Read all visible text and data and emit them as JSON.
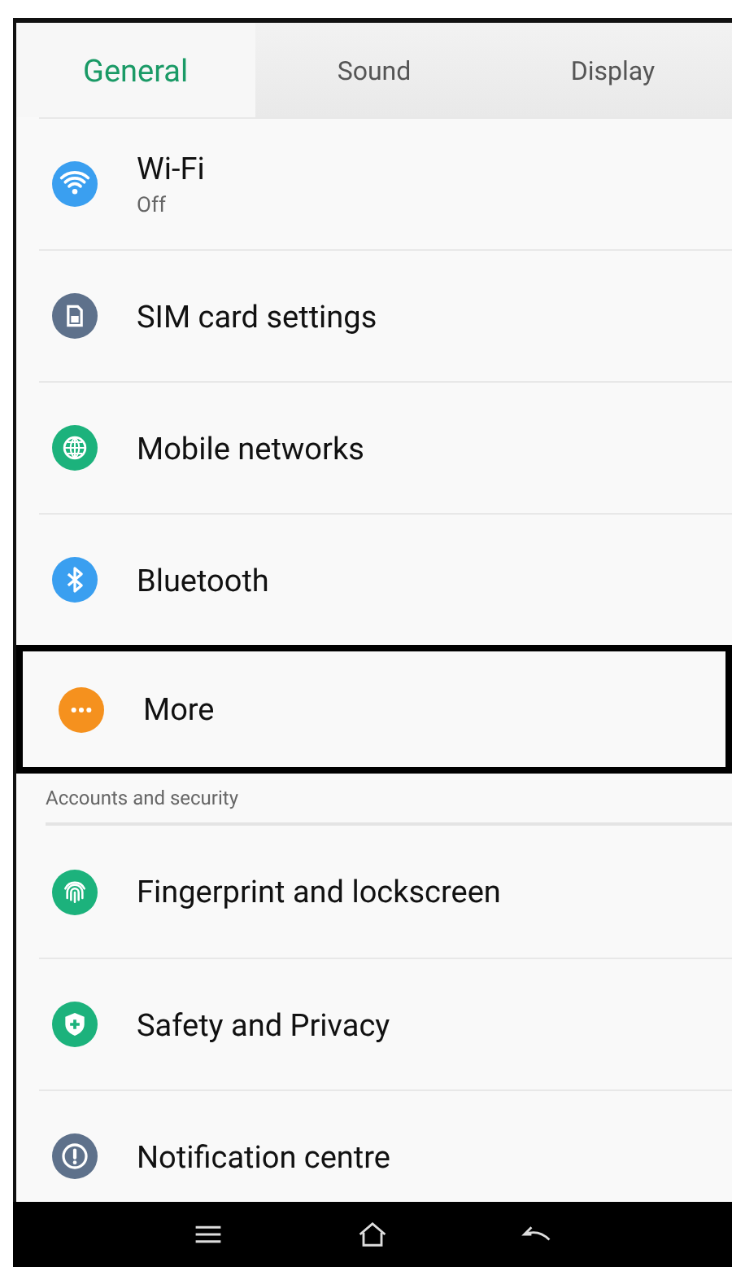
{
  "tabs": [
    {
      "label": "General",
      "selected": true
    },
    {
      "label": "Sound",
      "selected": false
    },
    {
      "label": "Display",
      "selected": false
    }
  ],
  "sections": [
    {
      "items": [
        {
          "kind": "wifi",
          "color": "#3a9ff0",
          "title": "Wi-Fi",
          "subtitle": "Off",
          "selected": false
        },
        {
          "kind": "sim",
          "color": "#5e718b",
          "title": "SIM card settings",
          "selected": false
        },
        {
          "kind": "globe",
          "color": "#1cb27c",
          "title": "Mobile networks",
          "selected": false
        },
        {
          "kind": "bluetooth",
          "color": "#3a9ff0",
          "title": "Bluetooth",
          "selected": false
        },
        {
          "kind": "more",
          "color": "#f5911e",
          "title": "More",
          "selected": true
        }
      ]
    },
    {
      "header": "Accounts and security",
      "items": [
        {
          "kind": "fingerprint",
          "color": "#1cb27c",
          "title": "Fingerprint and lockscreen",
          "selected": false
        },
        {
          "kind": "shield",
          "color": "#1cb27c",
          "title": "Safety and Privacy",
          "selected": false
        },
        {
          "kind": "alert",
          "color": "#5e718b",
          "title": "Notification centre",
          "selected": false
        }
      ]
    }
  ],
  "nav_bar": [
    {
      "kind": "menu"
    },
    {
      "kind": "home"
    },
    {
      "kind": "back"
    }
  ]
}
